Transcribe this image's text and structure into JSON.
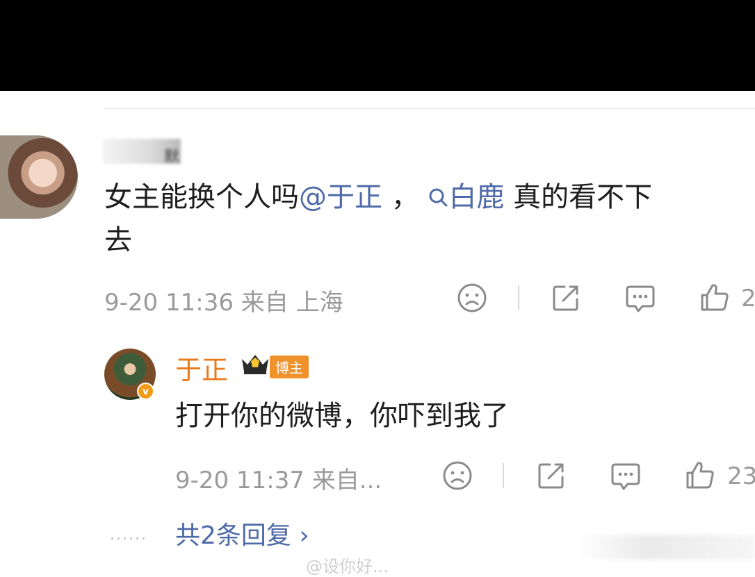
{
  "comment1": {
    "username_suffix": "默",
    "text_prefix": "女主能换个人吗",
    "mention": "@于正",
    "text_comma": " ，",
    "search_icon": "search-icon",
    "search_link": "白鹿",
    "text_suffix": " 真的看不下",
    "text_line2": "去",
    "timestamp": "9-20 11:36",
    "source": "来自 上海",
    "like_count": "2"
  },
  "reply": {
    "username": "于正",
    "badge": "博主",
    "verified_mark": "v",
    "text": "打开你的微博，你吓到我了",
    "timestamp": "9-20 11:37",
    "source": "来自...",
    "like_count": "23"
  },
  "more_replies": "共2条回复 ›",
  "dots": "......",
  "watermark": "@设你好...",
  "colors": {
    "link": "#4e6aa8",
    "author_name": "#e8791c",
    "badge": "#f0922b"
  }
}
